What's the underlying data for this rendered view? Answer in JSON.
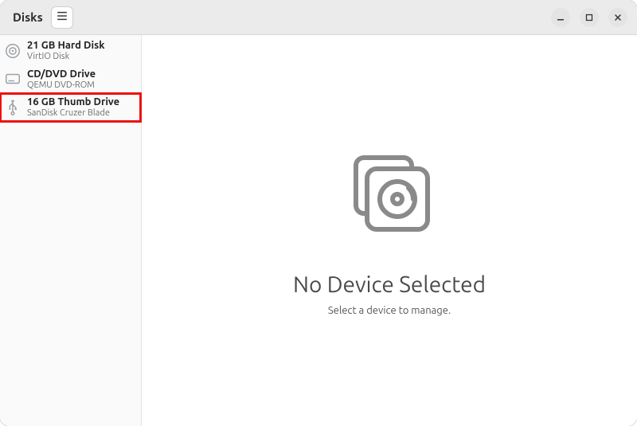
{
  "header": {
    "title": "Disks"
  },
  "sidebar": {
    "devices": [
      {
        "name": "21 GB Hard Disk",
        "sub": "VirtIO Disk",
        "icon": "hdd"
      },
      {
        "name": "CD/DVD Drive",
        "sub": "QEMU DVD-ROM",
        "icon": "optical"
      },
      {
        "name": "16 GB Thumb Drive",
        "sub": "SanDisk Cruzer Blade",
        "icon": "usb"
      }
    ]
  },
  "main": {
    "title": "No Device Selected",
    "subtitle": "Select a device to manage."
  },
  "annotation": {
    "highlighted_index": 2
  }
}
